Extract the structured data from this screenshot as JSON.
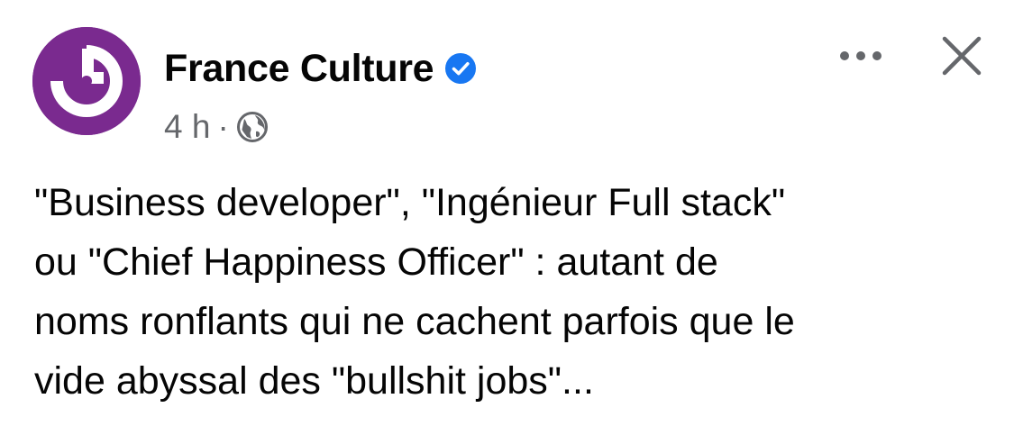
{
  "post": {
    "page_name": "France Culture",
    "verified": true,
    "time": "4 h",
    "separator": "·",
    "audience_icon": "globe-icon",
    "avatar_icon": "france-culture-logo",
    "more_icon": "more-dots-icon",
    "close_icon": "close-icon",
    "text_lines": [
      "\"Business developer\", \"Ingénieur Full stack\"",
      "ou \"Chief Happiness Officer\" : autant de",
      "noms ronflants qui ne cachent parfois que le",
      "vide abyssal des \"bullshit jobs\"..."
    ]
  },
  "colors": {
    "avatar_bg": "#7a2a8f",
    "verified_blue": "#1877f2",
    "meta_gray": "#65676b",
    "text": "#050505"
  }
}
